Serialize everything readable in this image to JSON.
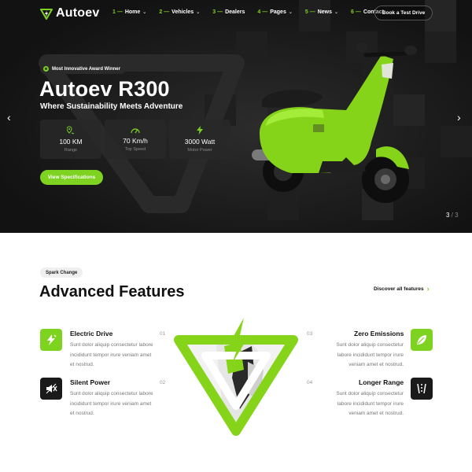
{
  "brand": {
    "name": "Autoev",
    "accent": "#7ed321",
    "dark": "#161616"
  },
  "nav": {
    "items": [
      {
        "num": "1 —",
        "label": "Home",
        "caret": true
      },
      {
        "num": "2 —",
        "label": "Vehicles",
        "caret": true
      },
      {
        "num": "3 —",
        "label": "Dealers",
        "caret": false
      },
      {
        "num": "4 —",
        "label": "Pages",
        "caret": true
      },
      {
        "num": "5 —",
        "label": "News",
        "caret": true
      },
      {
        "num": "6 —",
        "label": "Contact",
        "caret": false
      }
    ],
    "cta": "Book a Test Drive"
  },
  "hero": {
    "badge": "Most Innovative Award Winner",
    "title": "Autoev R300",
    "subtitle": "Where Sustainability Meets Adventure",
    "stats": [
      {
        "icon": "location-pin-icon",
        "value": "100 KM",
        "label": "Range"
      },
      {
        "icon": "speedometer-icon",
        "value": "70 Km/h",
        "label": "Top Speed"
      },
      {
        "icon": "lightning-icon",
        "value": "3000 Watt",
        "label": "Motor Power"
      }
    ],
    "button": "View Specifications",
    "slide_current": "3",
    "slide_separator": " / ",
    "slide_total": "3"
  },
  "features": {
    "tag": "Spark Change",
    "title": "Advanced Features",
    "discover": "Discover all features",
    "items": [
      {
        "num": "01",
        "title": "Electric Drive",
        "icon": "electric-bolt-icon",
        "desc": "Sunt dolor aliquip consectetur labore incididunt tempor irure veniam amet et nostrud."
      },
      {
        "num": "02",
        "title": "Silent Power",
        "icon": "mute-speaker-icon",
        "desc": "Sunt dolor aliquip consectetur labore incididunt tempor irure veniam amet et nostrud."
      },
      {
        "num": "03",
        "title": "Zero Emissions",
        "icon": "leaf-icon",
        "desc": "Sunt dolor aliquip consectetur labore incididunt tempor irure veniam amet et nostrud."
      },
      {
        "num": "04",
        "title": "Longer Range",
        "icon": "road-icon",
        "desc": "Sunt dolor aliquip consectetur labore incididunt tempor irure veniam amet et nostrud."
      }
    ]
  }
}
